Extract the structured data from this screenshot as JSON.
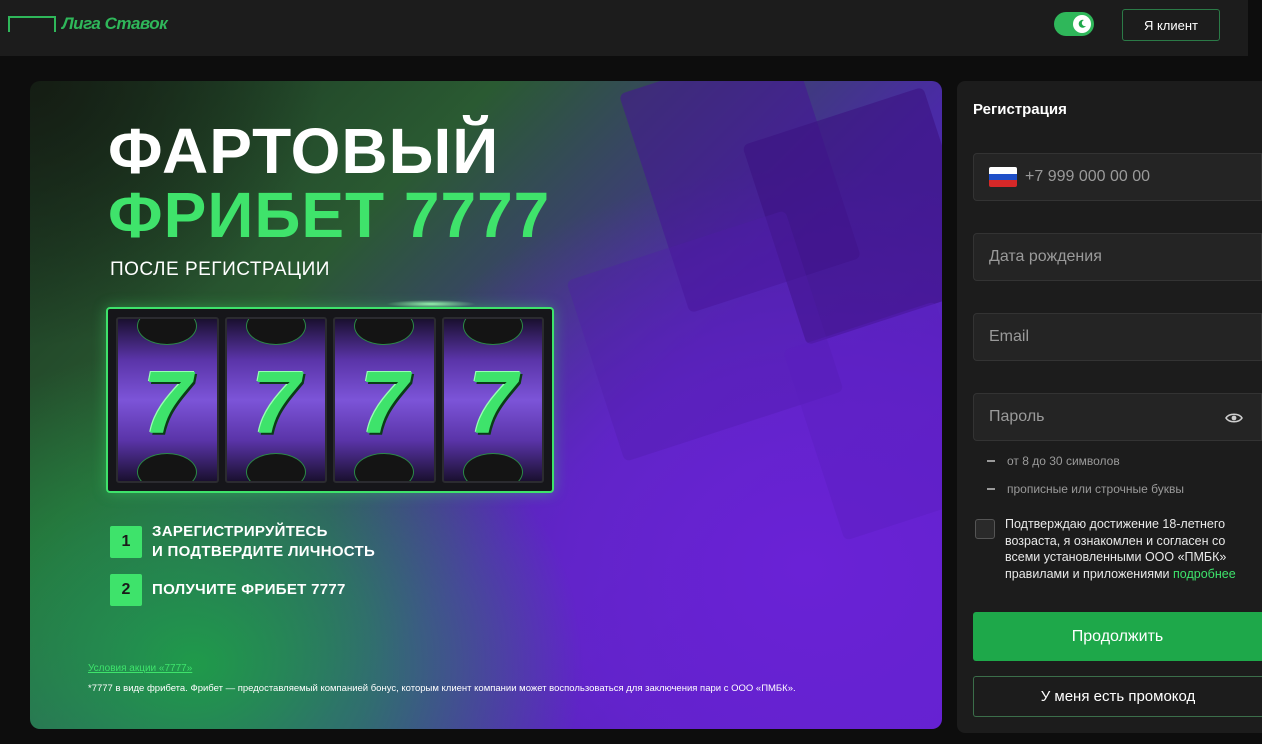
{
  "header": {
    "logo_text": "Лига Ставок",
    "client_button": "Я клиент",
    "theme_toggle_state": "on"
  },
  "promo": {
    "title_line1": "ФАРТОВЫЙ",
    "title_line2": "ФРИБЕТ 7777",
    "subtitle": "ПОСЛЕ РЕГИСТРАЦИИ",
    "reels": [
      "7",
      "7",
      "7",
      "7"
    ],
    "steps": [
      {
        "num": "1",
        "line1": "ЗАРЕГИСТРИРУЙТЕСЬ",
        "line2": "И ПОДТВЕРДИТЕ ЛИЧНОСТЬ"
      },
      {
        "num": "2",
        "line1": "ПОЛУЧИТЕ ФРИБЕТ 7777",
        "line2": ""
      }
    ],
    "terms_link": "Условия акции «7777»",
    "footnote": "*7777 в виде фрибета. Фрибет — предоставляемый компанией бонус, которым клиент компании может воспользоваться для заключения пари с ООО «ПМБК»."
  },
  "registration": {
    "title": "Регистрация",
    "phone_placeholder": "+7 999 000 00 00",
    "birthdate_placeholder": "Дата рождения",
    "email_placeholder": "Email",
    "password_placeholder": "Пароль",
    "password_hints": [
      "от 8 до 30 символов",
      "прописные или строчные буквы"
    ],
    "consent_text": "Подтверждаю достижение 18-летнего возраста, я ознакомлен и согласен со всеми установленными ООО «ПМБК» правилами и приложениями",
    "consent_link": "подробнее",
    "continue_button": "Продолжить",
    "promo_button": "У меня есть промокод"
  },
  "colors": {
    "accent_green": "#3ee36b",
    "button_green": "#1ea84a",
    "panel_bg": "#1c1c1c"
  }
}
